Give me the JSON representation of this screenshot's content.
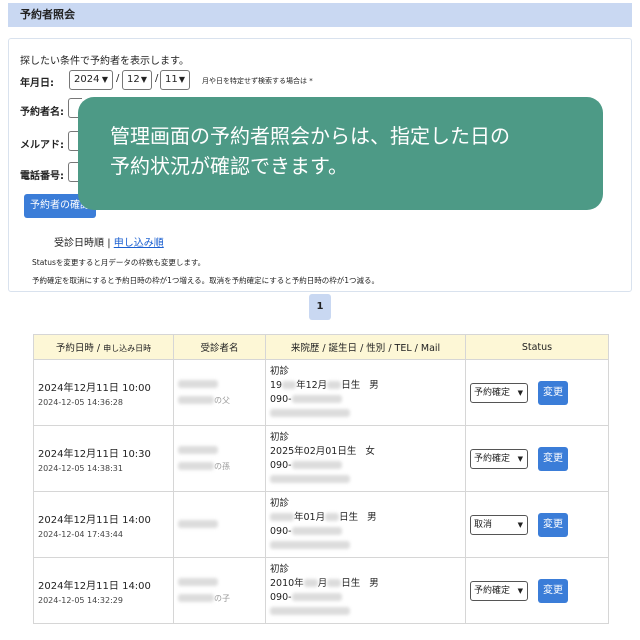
{
  "header": {
    "title": "予約者照会"
  },
  "search": {
    "intro": "探したい条件で予約者を表示します。",
    "date_label": "年月日:",
    "year": "2024",
    "month": "12",
    "day": "11",
    "slash": "/",
    "date_note": "月や日を特定せず検索する場合は *",
    "name_label": "予約者名:",
    "mail_label": "メルアド:",
    "phone_label": "電話番号:",
    "confirm_button": "予約者の確認"
  },
  "sort": {
    "by_visit": "受診日時順",
    "separator": "|",
    "by_application": "申し込み順"
  },
  "notes": {
    "line1": "Statusを変更すると月データの枠数も変更します。",
    "line2": "予約確定を取消にすると予約日時の枠が1つ増える。取消を予約確定にすると予約日時の枠が1つ減る。"
  },
  "callout": {
    "line1": "管理画面の予約者照会からは、指定した日の",
    "line2": "予約状況が確認できます。"
  },
  "pagination": {
    "current": "1"
  },
  "table": {
    "headers": {
      "datetime": "予約日時 / ",
      "datetime_sub": "申し込み日時",
      "patient": "受診者名",
      "profile": "来院歴 / 誕生日 / 性別 / TEL / Mail",
      "status": "Status"
    },
    "rows": [
      {
        "datetime": "2024年12月11日 10:00",
        "applied": "2024-12-05 14:36:28",
        "relation": "の父",
        "visit": "初診",
        "birth_a": "19",
        "birth_b": "年12月",
        "birth_c": "日生",
        "gender": "男",
        "tel": "090-",
        "status": "予約確定"
      },
      {
        "datetime": "2024年12月11日 10:30",
        "applied": "2024-12-05 14:38:31",
        "relation": "の孫",
        "visit": "初診",
        "birth_a": "2025年02月01日生",
        "birth_b": "",
        "birth_c": "",
        "gender": "女",
        "tel": "090-",
        "status": "予約確定"
      },
      {
        "datetime": "2024年12月11日 14:00",
        "applied": "2024-12-04 17:43:44",
        "relation": "",
        "visit": "初診",
        "birth_a": "",
        "birth_b": "年01月",
        "birth_c": "日生",
        "gender": "男",
        "tel": "090-",
        "status": "取消"
      },
      {
        "datetime": "2024年12月11日 14:00",
        "applied": "2024-12-05 14:32:29",
        "relation": "の子",
        "visit": "初診",
        "birth_a": "2010年",
        "birth_b": "月",
        "birth_c": "日生",
        "gender": "男",
        "tel": "090-",
        "status": "予約確定"
      }
    ],
    "change_label": "変更"
  },
  "icons": {
    "dropdown": "chevron-down-icon"
  },
  "colors": {
    "header_bg": "#c9d8f2",
    "callout_bg": "#4d9a86",
    "button_bg": "#3b7dd8",
    "table_head_bg": "#fdf7d6"
  }
}
